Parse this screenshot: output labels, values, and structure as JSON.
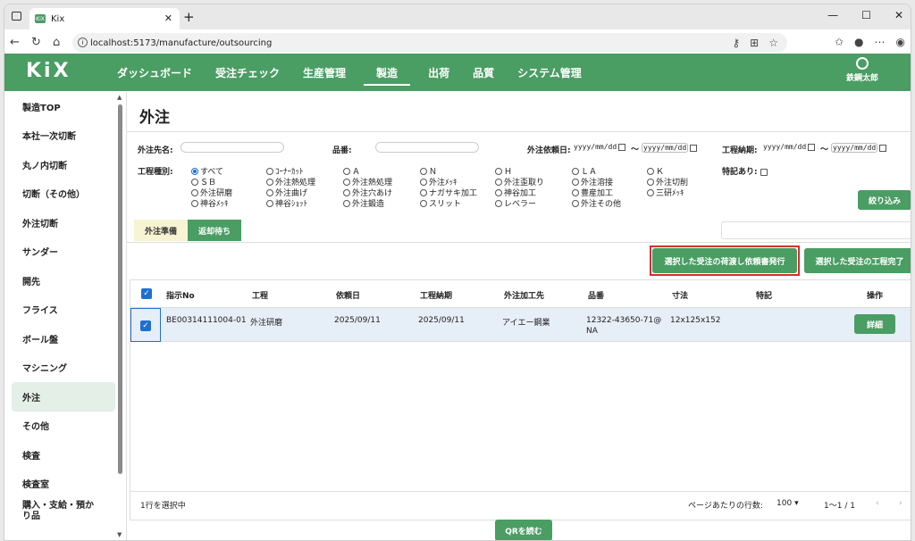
{
  "browser": {
    "tab_title": "Kix",
    "favicon_text": "KiX",
    "url": "localhost:5173/manufacture/outsourcing"
  },
  "app": {
    "logo": "KiX",
    "menu": [
      "ダッシュボード",
      "受注チェック",
      "生産管理",
      "製造",
      "出荷",
      "品質",
      "システム管理"
    ],
    "user": "鉄鋼太郎",
    "accent": "#4a9d63"
  },
  "sidebar": {
    "items": [
      "製造TOP",
      "本社一次切断",
      "丸ノ内切断",
      "切断（その他）",
      "外注切断",
      "サンダー",
      "開先",
      "フライス",
      "ボール盤",
      "マシニング",
      "外注",
      "その他",
      "検査",
      "検査室",
      "購入・支給・預かり品"
    ]
  },
  "page": {
    "title": "外注",
    "filters": {
      "vendor_label": "外注先名:",
      "part_label": "品番:",
      "request_date_label": "外注依頼日:",
      "process_due_label": "工程納期:",
      "date_placeholder": "yyyy/mm/dd",
      "tilde": "～",
      "process_type_label": "工程種別:",
      "special_label": "特記あり:",
      "radios": [
        "すべて",
        "ｺｰﾅｰｶｯﾄ",
        "Ａ",
        "Ｎ",
        "Ｈ",
        "ＬＡ",
        "Ｋ",
        "ＳＢ",
        "外注熱処理",
        "外注熱処理",
        "外注ﾒｯｷ",
        "外注歪取り",
        "外注溶接",
        "外注切削",
        "外注研磨",
        "外注曲げ",
        "外注穴あけ",
        "ナガサキ加工",
        "神谷加工",
        "豊産加工",
        "三研ﾒｯｷ",
        "神谷ﾒｯｷ",
        "神谷ｼｮｯﾄ",
        "外注鍛造",
        "スリット",
        "レベラー",
        "外注その他"
      ],
      "filter_button": "絞り込み"
    },
    "tabs": [
      "外注準備",
      "返却待ち"
    ],
    "actions": {
      "issue_request": "選択した受注の荷渡し依頼書発行",
      "complete_process": "選択した受注の工程完了"
    },
    "table": {
      "headers": [
        "指示No",
        "工程",
        "依頼日",
        "工程納期",
        "外注加工先",
        "品番",
        "寸法",
        "特記",
        "操作"
      ],
      "rows": [
        {
          "no": "BE00314111004-01",
          "process": "外注研磨",
          "request_date": "2025/09/11",
          "due": "2025/09/11",
          "vendor": "アイエー鋼業",
          "part": "12322-43650-71@",
          "part2": "NA",
          "size": "12x125x152",
          "special": "",
          "action": "詳細"
        }
      ]
    },
    "footer": {
      "selected": "1行を選択中",
      "rows_per_page_label": "ページあたりの行数:",
      "rows_per_page": "100",
      "range": "1～1 / 1"
    },
    "qr_button": "QRを読む"
  }
}
